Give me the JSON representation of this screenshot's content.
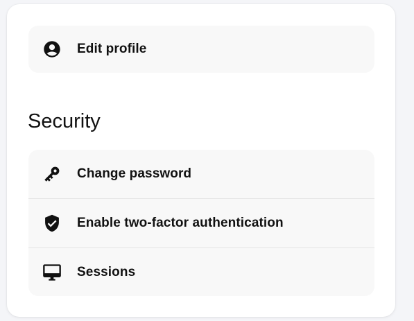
{
  "profile": {
    "items": [
      {
        "label": "Edit profile",
        "icon": "account-circle-icon"
      }
    ]
  },
  "security": {
    "title": "Security",
    "items": [
      {
        "label": "Change password",
        "icon": "key-icon"
      },
      {
        "label": "Enable two-factor authentication",
        "icon": "shield-check-icon"
      },
      {
        "label": "Sessions",
        "icon": "monitor-icon"
      }
    ]
  },
  "colors": {
    "page_background": "#f4f5f8",
    "card_background": "#ffffff",
    "row_background": "#f8f8f8",
    "text": "#111111",
    "divider": "#e4e4e4"
  }
}
